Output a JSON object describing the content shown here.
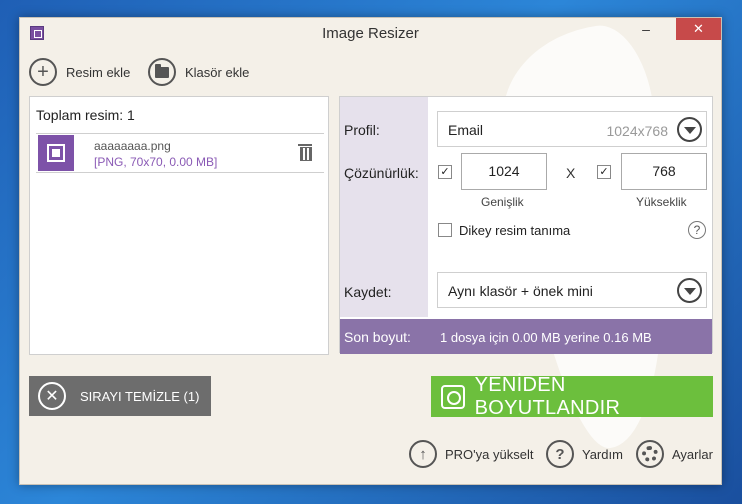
{
  "window": {
    "title": "Image Resizer",
    "minimize_glyph": "–",
    "close_glyph": "✕"
  },
  "toolbar": {
    "add_image_label": "Resim ekle",
    "add_folder_label": "Klasör ekle"
  },
  "file_list": {
    "total_label": "Toplam resim: 1",
    "items": [
      {
        "name": "aaaaaaaa.png",
        "info": "[PNG, 70x70, 0.00 MB]"
      }
    ]
  },
  "settings": {
    "profile_label": "Profil:",
    "profile_value": "Email",
    "profile_hint": "1024x768",
    "resolution_label": "Çözünürlük:",
    "width_value": "1024",
    "height_value": "768",
    "x_separator": "X",
    "width_label": "Genişlik",
    "height_label": "Yükseklik",
    "width_checked": "✓",
    "height_checked": "✓",
    "portrait_label": "Dikey resim tanıma",
    "help_glyph": "?",
    "save_label": "Kaydet:",
    "save_value": "Aynı klasör + önek mini",
    "size_label": "Son boyut:",
    "size_text": "1 dosya için 0.00 MB yerine 0.16 MB"
  },
  "actions": {
    "clear_label": "SIRAYI TEMİZLE (1)",
    "resize_label": "YENİDEN BOYUTLANDIR"
  },
  "footer": {
    "upgrade_label": "PRO'ya yükselt",
    "help_label": "Yardım",
    "help_glyph": "?",
    "settings_label": "Ayarlar"
  },
  "colors": {
    "accent_purple": "#8a73a8",
    "resize_green": "#6cbf3d",
    "clear_gray": "#6d6d6d",
    "close_red": "#c74a4a"
  }
}
